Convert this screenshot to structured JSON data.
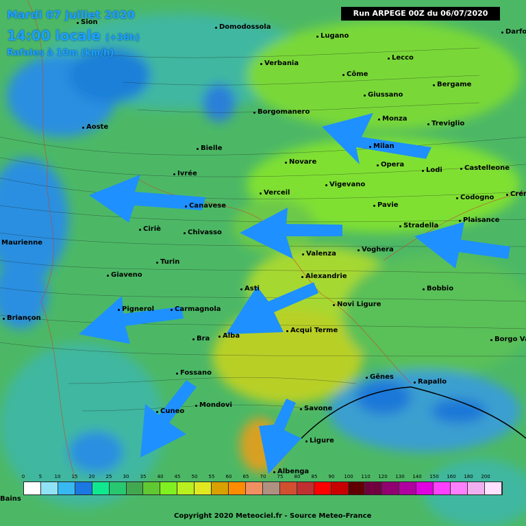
{
  "header": {
    "date": "Mardi 07 juillet 2020",
    "time_label": "14:00 locale",
    "time_offset": "(+36h)",
    "parameter": "Rafales à 10m (km/h)",
    "run": "Run ARPEGE 00Z du 06/07/2020"
  },
  "cities": [
    {
      "name": "Domodossola"
    },
    {
      "name": "Lugano"
    },
    {
      "name": "Darfo"
    },
    {
      "name": "Sion"
    },
    {
      "name": "Verbania"
    },
    {
      "name": "Lecco"
    },
    {
      "name": "Côme"
    },
    {
      "name": "Bergame"
    },
    {
      "name": "Giussano"
    },
    {
      "name": "Borgomanero"
    },
    {
      "name": "Monza"
    },
    {
      "name": "Treviglio"
    },
    {
      "name": "Aoste"
    },
    {
      "name": "Bielle"
    },
    {
      "name": "Milan"
    },
    {
      "name": "Novare"
    },
    {
      "name": "Opera"
    },
    {
      "name": "Lodi"
    },
    {
      "name": "Castelleone"
    },
    {
      "name": "Ivrée"
    },
    {
      "name": "Vigevano"
    },
    {
      "name": "Verceil"
    },
    {
      "name": "Codogno"
    },
    {
      "name": "Crémone"
    },
    {
      "name": "Canavese"
    },
    {
      "name": "Pavie"
    },
    {
      "name": "Plaisance"
    },
    {
      "name": "Ciriè"
    },
    {
      "name": "Chivasso"
    },
    {
      "name": "Stradella"
    },
    {
      "name": "Valenza"
    },
    {
      "name": "Voghera"
    },
    {
      "name": "Maurienne"
    },
    {
      "name": "Turin"
    },
    {
      "name": "Giaveno"
    },
    {
      "name": "Alexandrie"
    },
    {
      "name": "Asti"
    },
    {
      "name": "Bobbio"
    },
    {
      "name": "Novi Ligure"
    },
    {
      "name": "Pignerol"
    },
    {
      "name": "Carmagnola"
    },
    {
      "name": "Briançon"
    },
    {
      "name": "Acqui Terme"
    },
    {
      "name": "Bra"
    },
    {
      "name": "Alba"
    },
    {
      "name": "Borgo Val di Taro"
    },
    {
      "name": "Fossano"
    },
    {
      "name": "Gênes"
    },
    {
      "name": "Rapallo"
    },
    {
      "name": "Mondovi"
    },
    {
      "name": "Savone"
    },
    {
      "name": "Cuneo"
    },
    {
      "name": "Ligure"
    },
    {
      "name": "Albenga"
    },
    {
      "name": "Bains"
    }
  ],
  "legend": {
    "values": [
      "0",
      "5",
      "10",
      "15",
      "20",
      "25",
      "30",
      "35",
      "40",
      "45",
      "50",
      "55",
      "60",
      "65",
      "70",
      "75",
      "80",
      "85",
      "90",
      "100",
      "110",
      "120",
      "130",
      "140",
      "150",
      "160",
      "180",
      "200"
    ],
    "colors": [
      "#ffffff",
      "#8fe3f5",
      "#38b8f0",
      "#1a78e0",
      "#10e890",
      "#28c870",
      "#42a850",
      "#60c830",
      "#80f020",
      "#b8f020",
      "#e0e820",
      "#d8a000",
      "#ff8c00",
      "#f09060",
      "#b09080",
      "#d05030",
      "#c03030",
      "#ff0000",
      "#c80000",
      "#600000",
      "#700040",
      "#900070",
      "#b000a0",
      "#e000e0",
      "#ff40ff",
      "#ff80ff",
      "#f0b0f0",
      "#ffe0ff"
    ]
  },
  "copyright": "Copyright 2020 Meteociel.fr - Source Meteo-France"
}
